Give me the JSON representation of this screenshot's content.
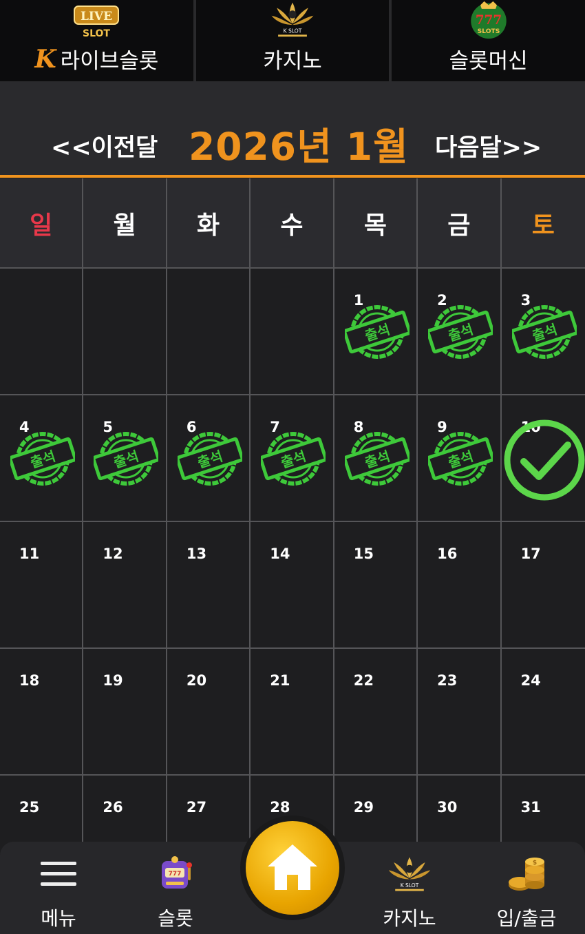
{
  "top_nav": {
    "tabs": [
      {
        "label": "라이브슬롯",
        "logo_text": "LIVE",
        "logo_sub": "SLOT",
        "brand_letter": "K"
      },
      {
        "label": "카지노",
        "logo_sub": "K SLOT"
      },
      {
        "label": "슬롯머신",
        "logo_text": "777",
        "logo_sub": "SLOTS"
      }
    ]
  },
  "month_header": {
    "prev_label": "<<이전달",
    "title": "2026년 1월",
    "next_label": "다음달>>"
  },
  "calendar": {
    "weekdays": [
      "일",
      "월",
      "화",
      "수",
      "목",
      "금",
      "토"
    ],
    "stamp_text": "출석",
    "cells": [
      {
        "day": "",
        "status": ""
      },
      {
        "day": "",
        "status": ""
      },
      {
        "day": "",
        "status": ""
      },
      {
        "day": "",
        "status": ""
      },
      {
        "day": "1",
        "status": "attended"
      },
      {
        "day": "2",
        "status": "attended"
      },
      {
        "day": "3",
        "status": "attended"
      },
      {
        "day": "4",
        "status": "attended"
      },
      {
        "day": "5",
        "status": "attended"
      },
      {
        "day": "6",
        "status": "attended"
      },
      {
        "day": "7",
        "status": "attended"
      },
      {
        "day": "8",
        "status": "attended"
      },
      {
        "day": "9",
        "status": "attended"
      },
      {
        "day": "10",
        "status": "checked"
      },
      {
        "day": "11",
        "status": ""
      },
      {
        "day": "12",
        "status": ""
      },
      {
        "day": "13",
        "status": ""
      },
      {
        "day": "14",
        "status": ""
      },
      {
        "day": "15",
        "status": ""
      },
      {
        "day": "16",
        "status": ""
      },
      {
        "day": "17",
        "status": ""
      },
      {
        "day": "18",
        "status": ""
      },
      {
        "day": "19",
        "status": ""
      },
      {
        "day": "20",
        "status": ""
      },
      {
        "day": "21",
        "status": ""
      },
      {
        "day": "22",
        "status": ""
      },
      {
        "day": "23",
        "status": ""
      },
      {
        "day": "24",
        "status": ""
      },
      {
        "day": "25",
        "status": ""
      },
      {
        "day": "26",
        "status": ""
      },
      {
        "day": "27",
        "status": ""
      },
      {
        "day": "28",
        "status": ""
      },
      {
        "day": "29",
        "status": ""
      },
      {
        "day": "30",
        "status": ""
      },
      {
        "day": "31",
        "status": ""
      }
    ]
  },
  "bottom_nav": {
    "menu_label": "메뉴",
    "slot_label": "슬롯",
    "home_icon": "home-icon",
    "casino_label": "카지노",
    "casino_logo_sub": "K SLOT",
    "deposit_label": "입/출금"
  },
  "colors": {
    "accent": "#f0931e",
    "sunday": "#e8384a",
    "stamp_green": "#3ec93a",
    "check_green": "#5cd64a"
  }
}
